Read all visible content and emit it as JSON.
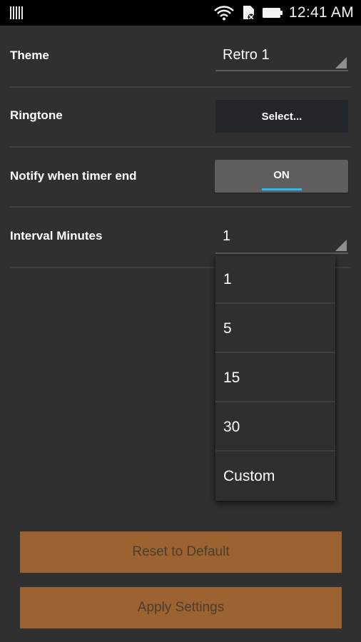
{
  "status_bar": {
    "time": "12:41 AM",
    "icons": [
      "barcode-icon",
      "wifi-icon",
      "sim-card-icon",
      "battery-icon"
    ]
  },
  "settings": {
    "theme": {
      "label": "Theme",
      "value": "Retro 1"
    },
    "ringtone": {
      "label": "Ringtone",
      "button": "Select..."
    },
    "notify": {
      "label": "Notify when timer end",
      "toggle": "ON"
    },
    "interval": {
      "label": "Interval Minutes",
      "value": "1"
    }
  },
  "dropdown": {
    "options": [
      "1",
      "5",
      "15",
      "30",
      "Custom"
    ]
  },
  "buttons": {
    "reset": "Reset to Default",
    "apply": "Apply Settings"
  },
  "colors": {
    "background": "#303030",
    "accent_orange": "#9c6330",
    "toggle_indicator": "#33b5e5"
  }
}
